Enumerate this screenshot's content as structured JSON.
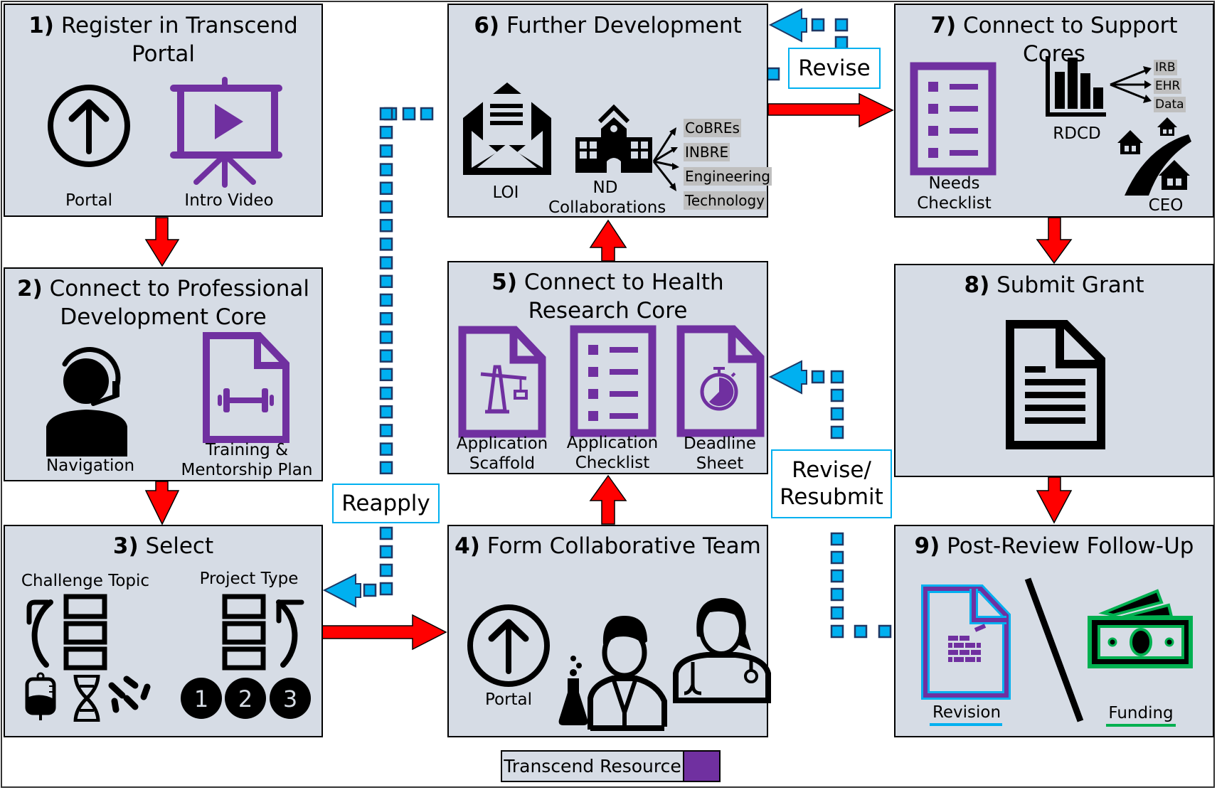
{
  "colors": {
    "box_fill": "#d6dce5",
    "transcend_purple": "#7030a0",
    "flow_arrow_red": "#ff0000",
    "feedback_blue": "#00b0f0",
    "feedback_border": "#1f3864",
    "funding_green": "#00b050"
  },
  "steps": [
    {
      "num": "1)",
      "title_line1": "Register in Transcend",
      "title_line2": "Portal",
      "items": [
        {
          "label": "Portal",
          "icon": "portal-upload-icon"
        },
        {
          "label": "Intro Video",
          "icon": "presentation-video-icon",
          "transcend_resource": true
        }
      ]
    },
    {
      "num": "2)",
      "title_line1": "Connect to Professional",
      "title_line2": "Development Core",
      "items": [
        {
          "label": "Navigation",
          "icon": "headset-person-icon"
        },
        {
          "label_line1": "Training &",
          "label_line2": "Mentorship Plan",
          "icon": "dumbbell-document-icon",
          "transcend_resource": true
        }
      ]
    },
    {
      "num": "3)",
      "title_line1": "Select",
      "items": [
        {
          "label": "Challenge Topic",
          "icon": "reorder-list-icon",
          "sub_icons": [
            "iv-bag-icon",
            "dna-icon",
            "bacteria-icon"
          ]
        },
        {
          "label": "Project Type",
          "icon": "reorder-list-icon",
          "numbers": [
            "1",
            "2",
            "3"
          ]
        }
      ]
    },
    {
      "num": "4)",
      "title_line1": "Form Collaborative Team",
      "items": [
        {
          "label": "Portal",
          "icon": "portal-upload-icon"
        },
        {
          "icon": "scientist-icon"
        },
        {
          "icon": "doctor-icon"
        }
      ]
    },
    {
      "num": "5)",
      "title_line1": "Connect to Health",
      "title_line2": "Research Core",
      "items": [
        {
          "label_line1": "Application",
          "label_line2": "Scaffold",
          "icon": "crane-document-icon",
          "transcend_resource": true
        },
        {
          "label_line1": "Application",
          "label_line2": "Checklist",
          "icon": "checklist-icon",
          "transcend_resource": true
        },
        {
          "label_line1": "Deadline",
          "label_line2": "Sheet",
          "icon": "stopwatch-document-icon",
          "transcend_resource": true
        }
      ]
    },
    {
      "num": "6)",
      "title_line1": "Further Development",
      "items": [
        {
          "label": "LOI",
          "icon": "open-envelope-icon"
        },
        {
          "label_line1": "ND",
          "label_line2": "Collaborations",
          "icon": "school-building-icon"
        }
      ],
      "collaborations": [
        "CoBREs",
        "INBRE",
        "Engineering",
        "Technology"
      ]
    },
    {
      "num": "7)",
      "title_line1": "Connect to Support",
      "title_line2": "Cores",
      "items": [
        {
          "label_line1": "Needs",
          "label_line2": "Checklist",
          "icon": "checklist-icon",
          "transcend_resource": true
        },
        {
          "label": "RDCD",
          "icon": "bar-chart-icon"
        },
        {
          "label": "CEO",
          "icon": "community-road-icon"
        }
      ],
      "rdcd_services": [
        "IRB",
        "EHR",
        "Data"
      ]
    },
    {
      "num": "8)",
      "title_line1": "Submit Grant",
      "items": [
        {
          "icon": "document-icon"
        }
      ]
    },
    {
      "num": "9)",
      "title_line1": "Post-Review Follow-Up",
      "items": [
        {
          "label": "Revision",
          "icon": "brick-document-icon"
        },
        {
          "label": "Funding",
          "icon": "money-icon"
        }
      ]
    }
  ],
  "feedback": {
    "revise": "Revise",
    "reapply": "Reapply",
    "revise_resubmit_line1": "Revise/",
    "revise_resubmit_line2": "Resubmit"
  },
  "legend": {
    "label": "Transcend Resource"
  }
}
